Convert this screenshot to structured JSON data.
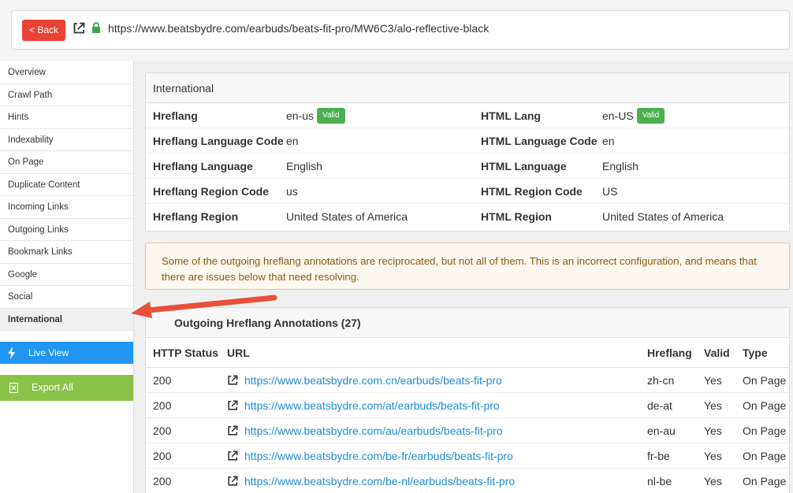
{
  "topbar": {
    "back_label": "< Back",
    "url": "https://www.beatsbydre.com/earbuds/beats-fit-pro/MW6C3/alo-reflective-black"
  },
  "sidebar": {
    "items": [
      {
        "label": "Overview"
      },
      {
        "label": "Crawl Path"
      },
      {
        "label": "Hints"
      },
      {
        "label": "Indexability"
      },
      {
        "label": "On Page"
      },
      {
        "label": "Duplicate Content"
      },
      {
        "label": "Incoming Links"
      },
      {
        "label": "Outgoing Links"
      },
      {
        "label": "Bookmark Links"
      },
      {
        "label": "Google"
      },
      {
        "label": "Social"
      },
      {
        "label": "International"
      }
    ],
    "live_view_label": "Live View",
    "export_all_label": "Export All"
  },
  "international": {
    "title": "International",
    "rows": [
      {
        "l1": "Hreflang",
        "v1": "en-us",
        "b1": "Valid",
        "l2": "HTML Lang",
        "v2": "en-US",
        "b2": "Valid"
      },
      {
        "l1": "Hreflang Language Code",
        "v1": "en",
        "l2": "HTML Language Code",
        "v2": "en"
      },
      {
        "l1": "Hreflang Language",
        "v1": "English",
        "l2": "HTML Language",
        "v2": "English"
      },
      {
        "l1": "Hreflang Region Code",
        "v1": "us",
        "l2": "HTML Region Code",
        "v2": "US"
      },
      {
        "l1": "Hreflang Region",
        "v1": "United States of America",
        "l2": "HTML Region",
        "v2": "United States of America"
      }
    ]
  },
  "warning": {
    "text": "Some of the outgoing hreflang annotations are reciprocated, but not all of them. This is an incorrect configuration, and means that there are issues below that need resolving."
  },
  "outgoing": {
    "title": "Outgoing Hreflang Annotations (27)",
    "headers": {
      "status": "HTTP Status",
      "url": "URL",
      "hreflang": "Hreflang",
      "valid": "Valid",
      "type": "Type"
    },
    "rows": [
      {
        "status": "200",
        "url": "https://www.beatsbydre.com.cn/earbuds/beats-fit-pro",
        "hreflang": "zh-cn",
        "valid": "Yes",
        "type": "On Page"
      },
      {
        "status": "200",
        "url": "https://www.beatsbydre.com/at/earbuds/beats-fit-pro",
        "hreflang": "de-at",
        "valid": "Yes",
        "type": "On Page"
      },
      {
        "status": "200",
        "url": "https://www.beatsbydre.com/au/earbuds/beats-fit-pro",
        "hreflang": "en-au",
        "valid": "Yes",
        "type": "On Page"
      },
      {
        "status": "200",
        "url": "https://www.beatsbydre.com/be-fr/earbuds/beats-fit-pro",
        "hreflang": "fr-be",
        "valid": "Yes",
        "type": "On Page"
      },
      {
        "status": "200",
        "url": "https://www.beatsbydre.com/be-nl/earbuds/beats-fit-pro",
        "hreflang": "nl-be",
        "valid": "Yes",
        "type": "On Page"
      }
    ]
  },
  "colors": {
    "back_button": "#ea4335",
    "live_view": "#2196f3",
    "export_all": "#8bc34a",
    "valid_badge": "#4caf50",
    "link": "#1f8dd6",
    "arrow": "#e8503c"
  }
}
